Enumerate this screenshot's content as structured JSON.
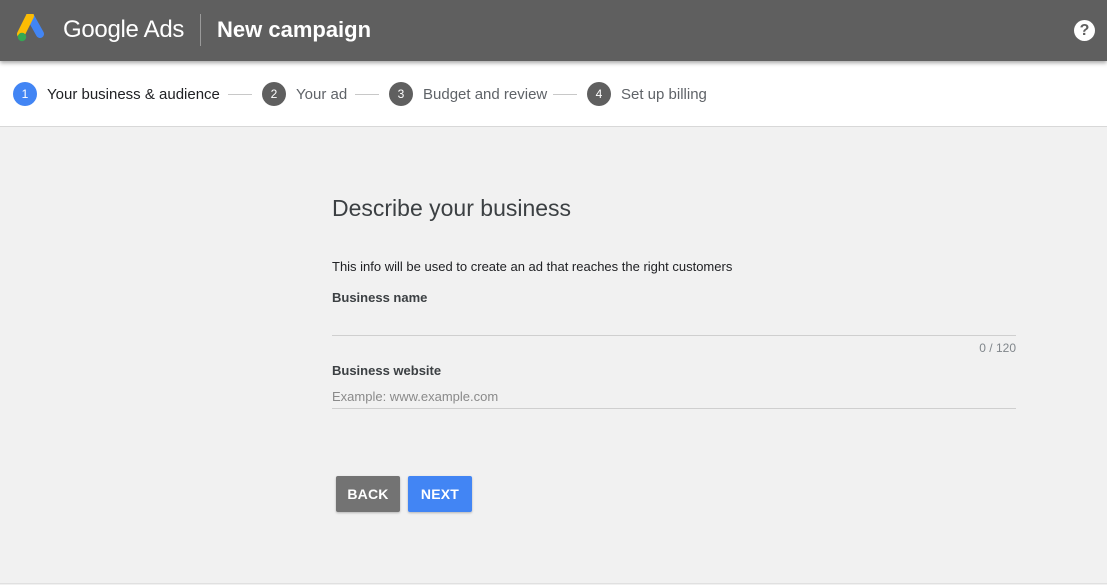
{
  "header": {
    "brand": "Google Ads",
    "title": "New campaign",
    "help_symbol": "?",
    "logo_colors": [
      "#fbbc04",
      "#4285f4",
      "#34a853"
    ]
  },
  "stepper": {
    "steps": [
      {
        "number": "1",
        "label": "Your business & audience",
        "active": true
      },
      {
        "number": "2",
        "label": "Your ad",
        "active": false
      },
      {
        "number": "3",
        "label": "Budget and review",
        "active": false
      },
      {
        "number": "4",
        "label": "Set up billing",
        "active": false
      }
    ],
    "active_color": "#4285f4"
  },
  "main": {
    "heading": "Describe your business",
    "subtext": "This info will be used to create an ad that reaches the right customers",
    "business_name": {
      "label": "Business name",
      "value": "",
      "placeholder": "",
      "counter": "0 / 120"
    },
    "business_website": {
      "label": "Business website",
      "value": "",
      "placeholder": "Example: www.example.com"
    }
  },
  "actions": {
    "back_label": "BACK",
    "next_label": "NEXT"
  }
}
